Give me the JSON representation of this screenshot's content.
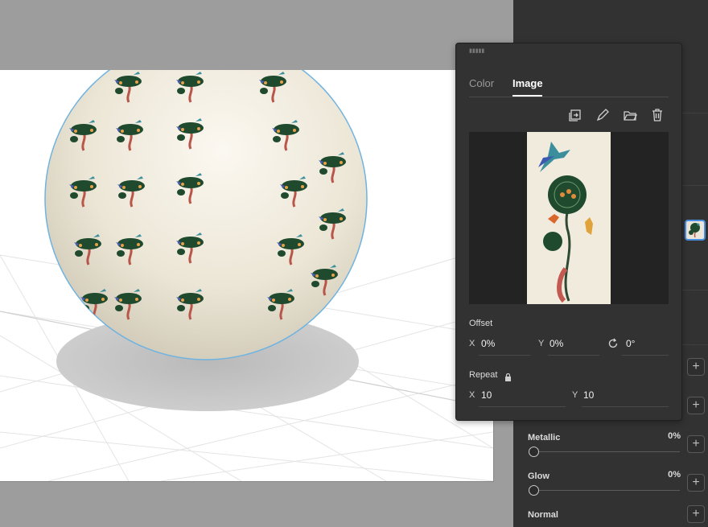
{
  "popover": {
    "tabs": {
      "color": "Color",
      "image": "Image"
    },
    "tools": [
      "replace-image-icon",
      "edit-pencil-icon",
      "open-folder-icon",
      "trash-icon"
    ],
    "offset": {
      "label": "Offset",
      "x_axis": "X",
      "x_value": "0%",
      "y_axis": "Y",
      "y_value": "0%",
      "rotation": "0°"
    },
    "repeat": {
      "label": "Repeat",
      "x_axis": "X",
      "x_value": "10",
      "y_axis": "Y",
      "y_value": "10"
    }
  },
  "properties": {
    "metallic": {
      "label": "Metallic",
      "value": "0%"
    },
    "glow": {
      "label": "Glow",
      "value": "0%"
    },
    "normal": {
      "label": "Normal"
    },
    "plus_symbol": "+"
  },
  "colors": {
    "accent": "#4a90e2",
    "panel": "#323232",
    "popover": "#323232"
  }
}
